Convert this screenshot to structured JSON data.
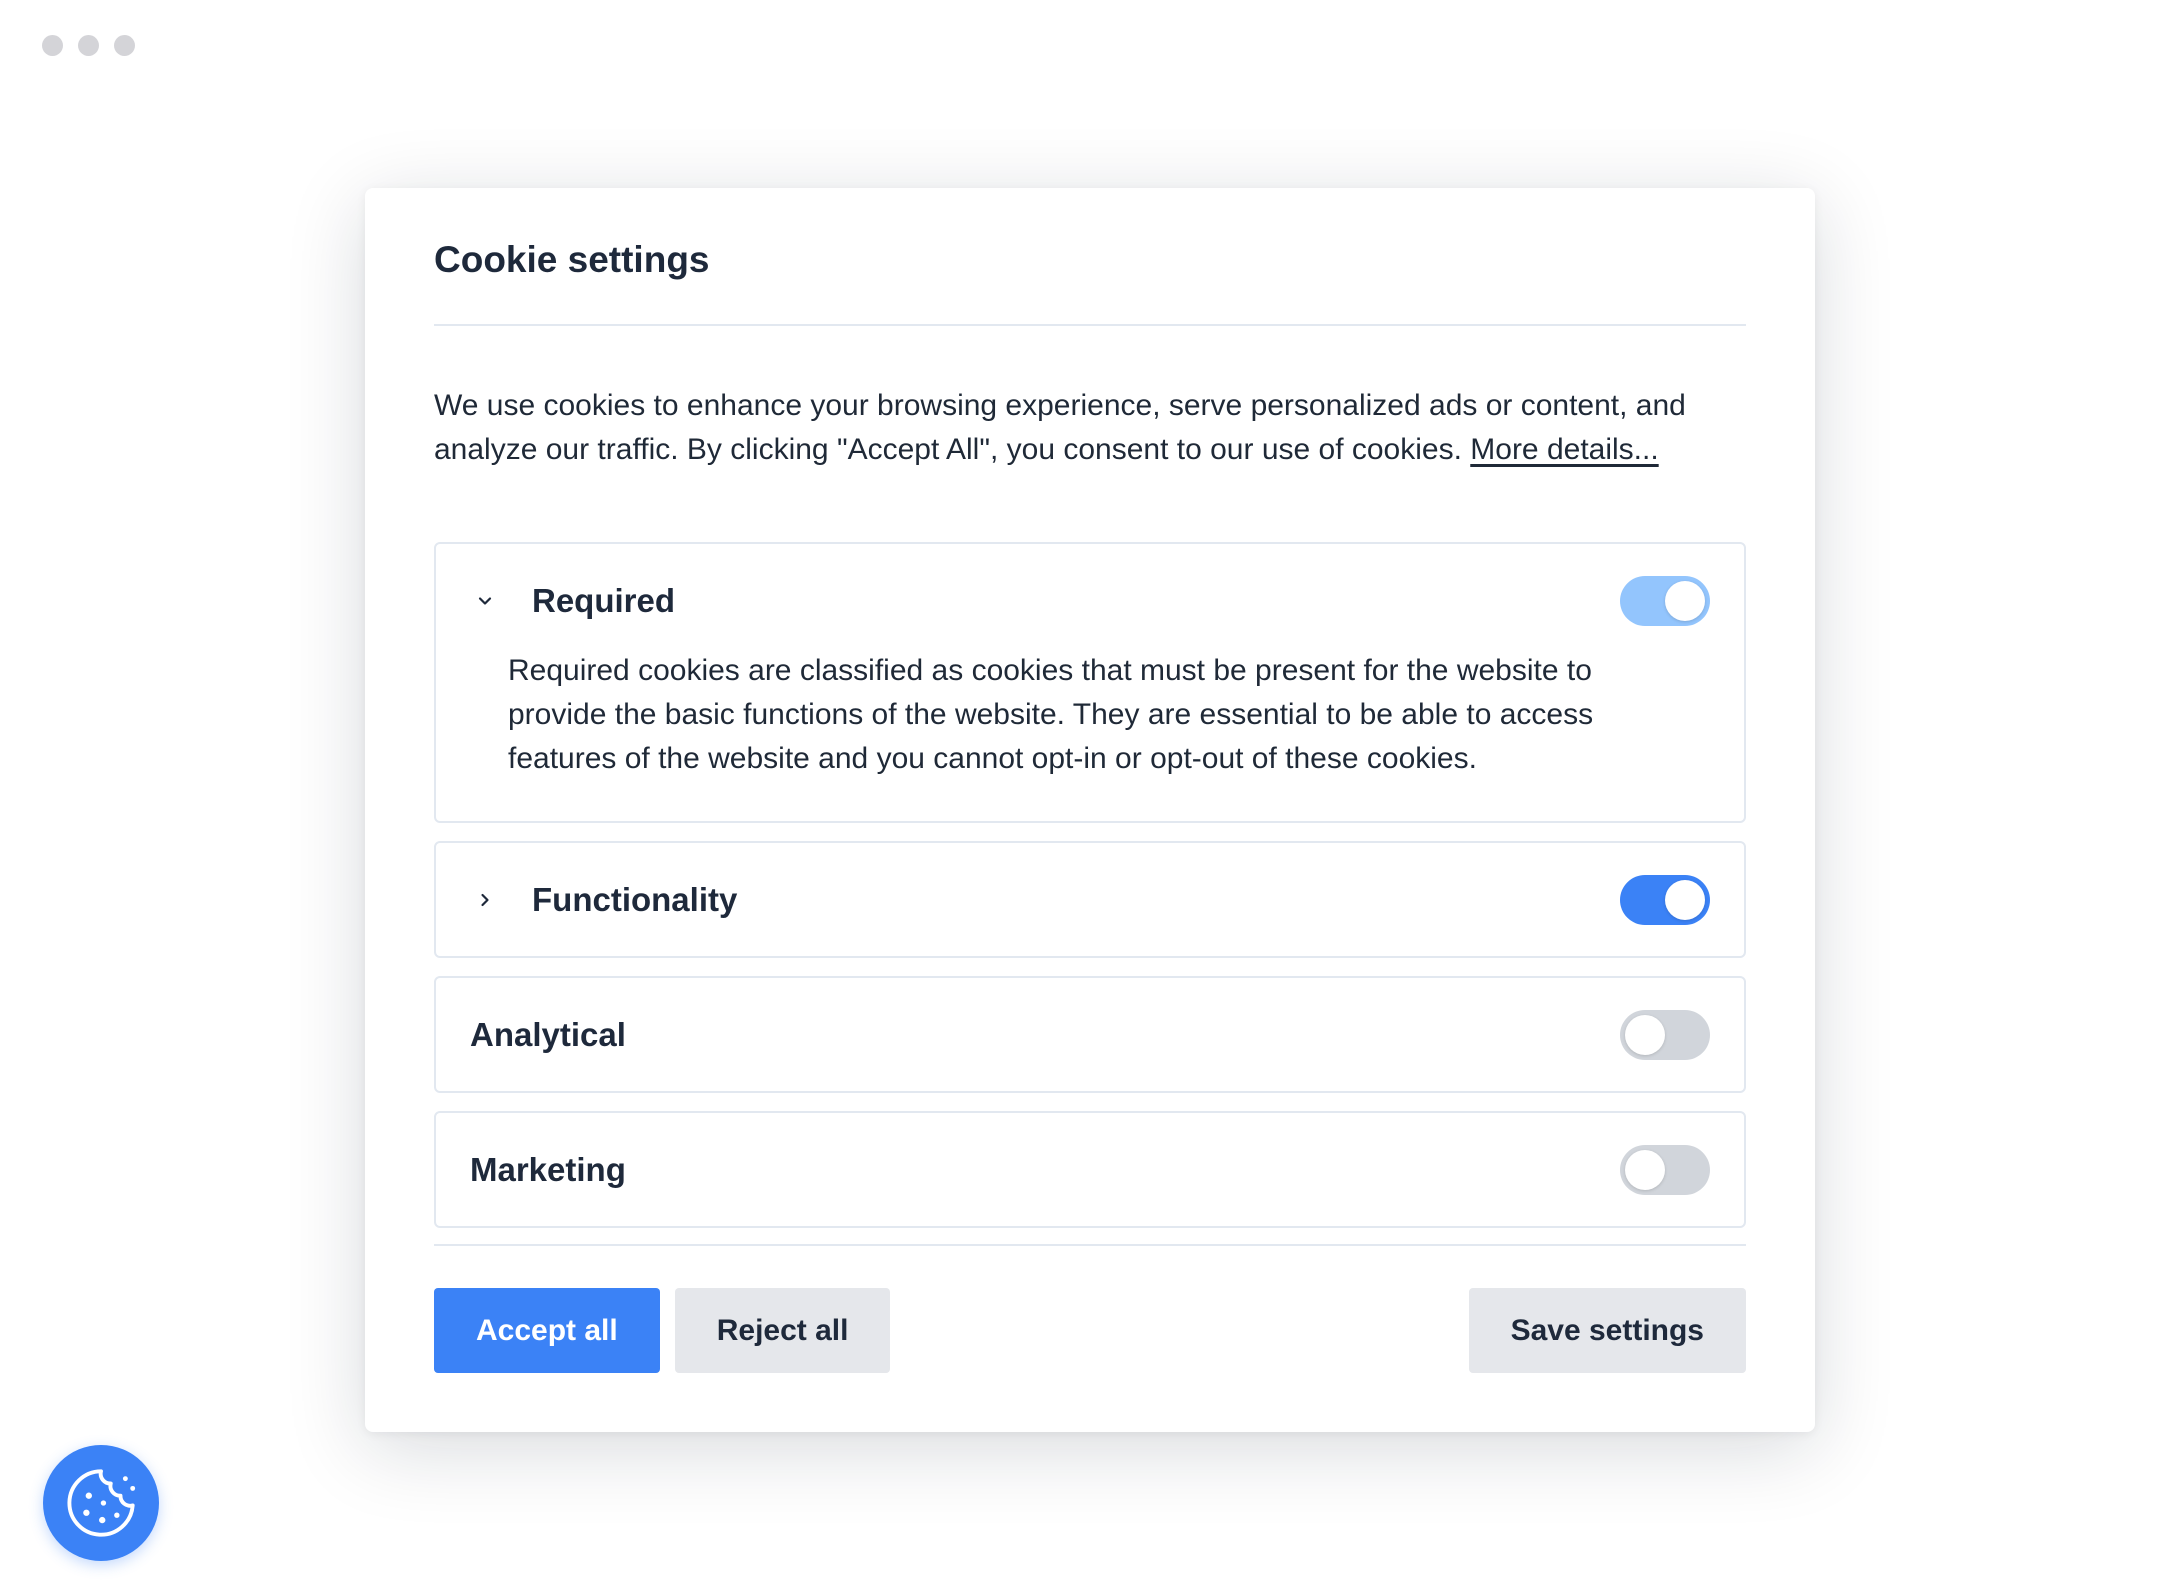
{
  "modal": {
    "title": "Cookie settings",
    "intro_text": "We use cookies to enhance your browsing experience, serve personalized ads or content, and analyze our traffic. By clicking \"Accept All\", you consent to our use of cookies. ",
    "more_link": "More details..."
  },
  "categories": [
    {
      "name": "Required",
      "expanded": true,
      "enabled": true,
      "locked": true,
      "description": "Required cookies are classified as cookies that must be present for the website to provide the basic functions of the website. They are essential to be able to access features of the website and you cannot opt-in or opt-out of these cookies."
    },
    {
      "name": "Functionality",
      "expanded": false,
      "enabled": true
    },
    {
      "name": "Analytical",
      "enabled": false
    },
    {
      "name": "Marketing",
      "enabled": false
    }
  ],
  "actions": {
    "accept_label": "Accept all",
    "reject_label": "Reject all",
    "save_label": "Save settings"
  },
  "icons": {
    "expanded": "chevron-down-icon",
    "collapsed": "chevron-right-icon",
    "fab": "cookie-icon"
  },
  "colors": {
    "accent": "#3b82f6",
    "accent_disabled": "#93c5fd",
    "toggle_off": "#d1d5db",
    "button_secondary": "#e5e7eb"
  }
}
